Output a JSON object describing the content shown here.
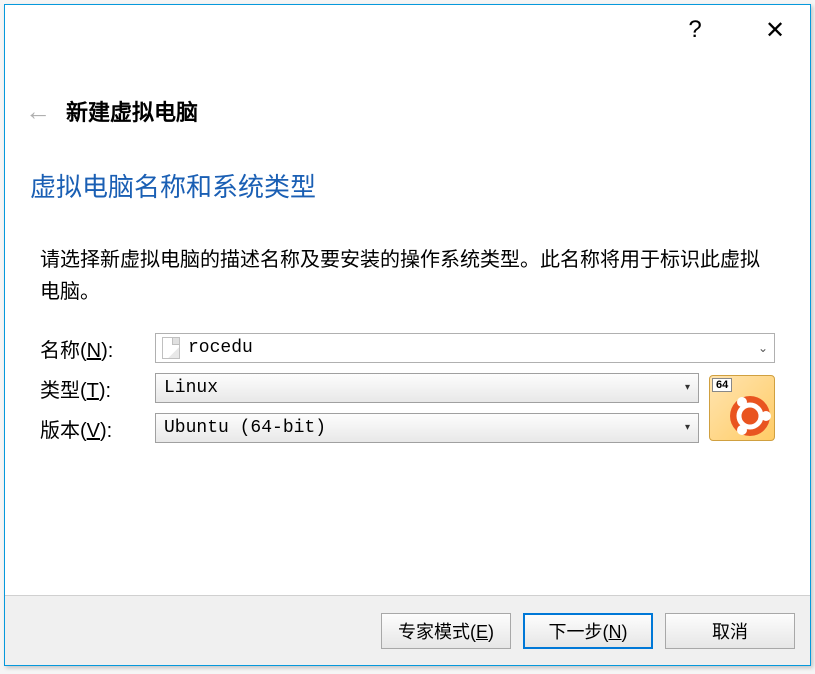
{
  "window": {
    "help_symbol": "?",
    "close_symbol": "✕"
  },
  "header": {
    "back_arrow": "←",
    "title": "新建虚拟电脑"
  },
  "section_title": "虚拟电脑名称和系统类型",
  "description": "请选择新虚拟电脑的描述名称及要安装的操作系统类型。此名称将用于标识此虚拟电脑。",
  "form": {
    "name_label_pre": "名称(",
    "name_label_key": "N",
    "name_label_post": "):",
    "name_value": "rocedu",
    "type_label_pre": "类型(",
    "type_label_key": "T",
    "type_label_post": "):",
    "type_value": "Linux",
    "version_label_pre": "版本(",
    "version_label_key": "V",
    "version_label_post": "):",
    "version_value": "Ubuntu (64-bit)",
    "os_badge": "64"
  },
  "footer": {
    "expert_pre": "专家模式(",
    "expert_key": "E",
    "expert_post": ")",
    "next_pre": "下一步(",
    "next_key": "N",
    "next_post": ")",
    "cancel": "取消"
  }
}
